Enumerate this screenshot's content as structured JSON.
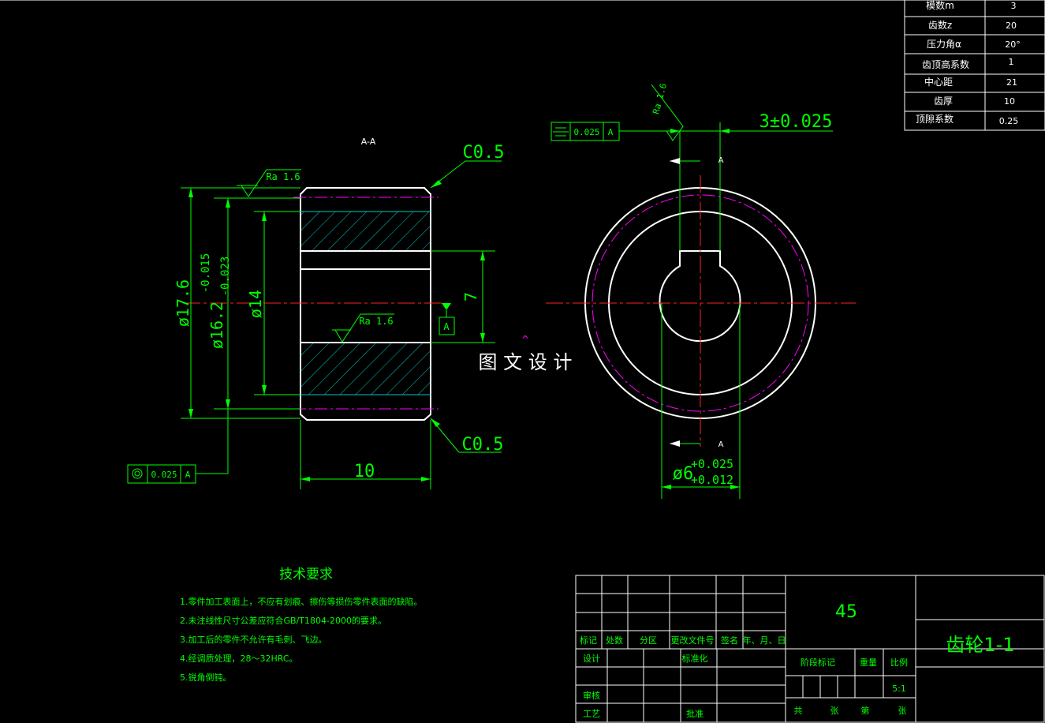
{
  "params": [
    {
      "label": "模数m",
      "value": "3"
    },
    {
      "label": "齿数z",
      "value": "20"
    },
    {
      "label": "压力角α",
      "value": "20°"
    },
    {
      "label": "齿顶高系数",
      "value": "1"
    },
    {
      "label": "中心距",
      "value": "21"
    },
    {
      "label": "齿厚",
      "value": "10"
    },
    {
      "label": "顶隙系数",
      "value": "0.25"
    }
  ],
  "section_label": "A-A",
  "chamfer_top": "C0.5",
  "chamfer_bottom": "C0.5",
  "ra_top": "Ra 1.6",
  "ra_bore": "Ra 1.6",
  "ra_key": "Ra 1.6",
  "dia_outer": "ø17.6",
  "dia_root_main": "ø16.2",
  "dia_root_tol_upper": "-0.015",
  "dia_root_tol_lower": "-0.023",
  "dia_bore": "ø14",
  "dim_seven": "7",
  "datum_letter": "A",
  "width": "10",
  "coax_tol": "0.025",
  "coax_datum": "A",
  "sym_tol": "0.025",
  "sym_datum": "A",
  "keyway_width": "3±0.025",
  "section_mark_top": "A",
  "section_mark_bottom": "A",
  "bore_main": "ø6",
  "bore_tol_upper": "+0.025",
  "bore_tol_lower": "+0.012",
  "watermark": "图 文 设 计",
  "tech_title": "技术要求",
  "tech_notes": [
    "1.零件加工表面上，不应有划痕、擦伤等损伤零件表面的缺陷。",
    "2.未注线性尺寸公差应符合GB/T1804-2000的要求。",
    "3.加工后的零件不允许有毛刺、飞边。",
    "4.经调质处理，28～32HRC。",
    "5.锐角倒钝。"
  ],
  "title_block": {
    "material": "45",
    "part_name": "齿轮1-1",
    "h_mark": "标记",
    "h_count": "处数",
    "h_zone": "分区",
    "h_doc": "更改文件号",
    "h_sign": "签名",
    "h_date": "年、月、日",
    "design": "设计",
    "standard": "标准化",
    "review": "审核",
    "process": "工艺",
    "approve": "批准",
    "stage": "阶段标记",
    "weight": "重量",
    "scale_label": "比例",
    "scale": "5:1",
    "total": "共",
    "sheets1": "张",
    "nth": "第",
    "sheets2": "张"
  }
}
